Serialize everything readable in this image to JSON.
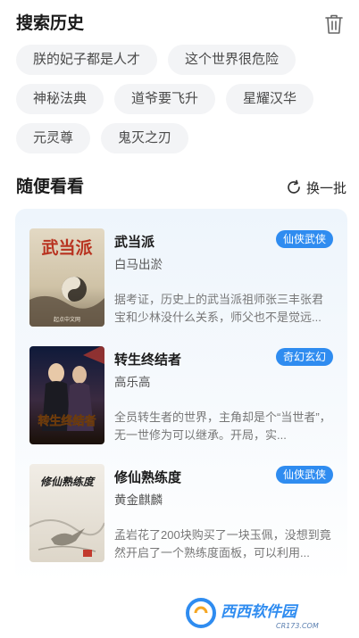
{
  "history": {
    "title": "搜索历史",
    "tags": [
      "朕的妃子都是人才",
      "这个世界很危险",
      "神秘法典",
      "道爷要飞升",
      "星耀汉华",
      "元灵尊",
      "鬼灭之刃"
    ]
  },
  "random": {
    "title": "随便看看",
    "refresh_label": "换一批",
    "books": [
      {
        "title": "武当派",
        "author": "白马出淤",
        "genre": "仙侠武侠",
        "description": "据考证，历史上的武当派祖师张三丰张君宝和少林没什么关系，师父也不是觉远...",
        "cover_title": "武当派",
        "cover_sub": "起点中文网"
      },
      {
        "title": "转生终结者",
        "author": "高乐高",
        "genre": "奇幻玄幻",
        "description": "全员转生者的世界，主角却是个“当世者”，无一世修为可以继承。开局，实...",
        "cover_title": "转生终结者"
      },
      {
        "title": "修仙熟练度",
        "author": "黄金麒麟",
        "genre": "仙侠武侠",
        "description": "孟岩花了200块购买了一块玉佩，没想到竟然开启了一个熟练度面板，可以利用...",
        "cover_title": "修仙熟练度"
      }
    ]
  },
  "watermark": {
    "text": "西西软件园",
    "url": "CR173.COM"
  },
  "colors": {
    "accent": "#2f8cf0",
    "tag_bg": "#f3f4f6"
  }
}
